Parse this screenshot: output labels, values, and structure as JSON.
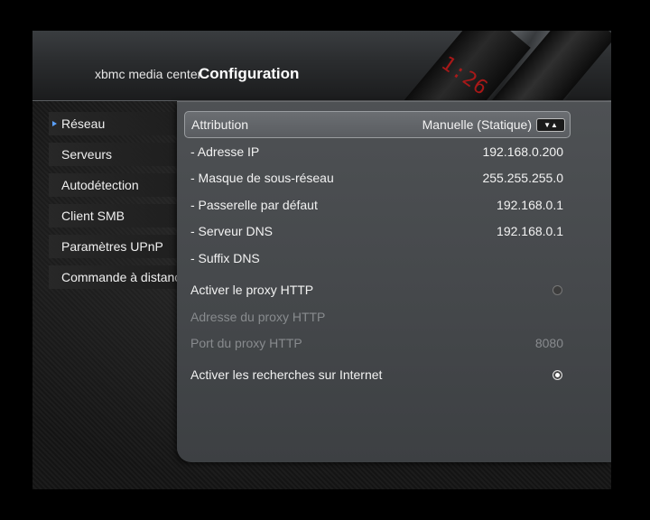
{
  "header": {
    "brand": "xbmc media center",
    "title": "Configuration",
    "clock": "1:26"
  },
  "sidebar": {
    "items": [
      {
        "label": "Réseau",
        "active": true
      },
      {
        "label": "Serveurs"
      },
      {
        "label": "Autodétection"
      },
      {
        "label": "Client SMB"
      },
      {
        "label": "Paramètres UPnP"
      },
      {
        "label": "Commande à distance"
      }
    ]
  },
  "settings": {
    "attribution": {
      "label": "Attribution",
      "value": "Manuelle (Statique)",
      "spin": "▼▲"
    },
    "ip": {
      "label": "- Adresse IP",
      "value": "192.168.0.200"
    },
    "mask": {
      "label": "- Masque de sous-réseau",
      "value": "255.255.255.0"
    },
    "gateway": {
      "label": "- Passerelle par défaut",
      "value": "192.168.0.1"
    },
    "dns": {
      "label": "- Serveur DNS",
      "value": "192.168.0.1"
    },
    "dns_suffix": {
      "label": "- Suffix DNS",
      "value": ""
    },
    "proxy_enable": {
      "label": "Activer le proxy HTTP",
      "checked": false
    },
    "proxy_address": {
      "label": "Adresse du proxy HTTP",
      "value": "",
      "disabled": true
    },
    "proxy_port": {
      "label": "Port du proxy HTTP",
      "value": "8080",
      "disabled": true
    },
    "internet_lookups": {
      "label": "Activer les recherches sur Internet",
      "checked": true
    }
  }
}
